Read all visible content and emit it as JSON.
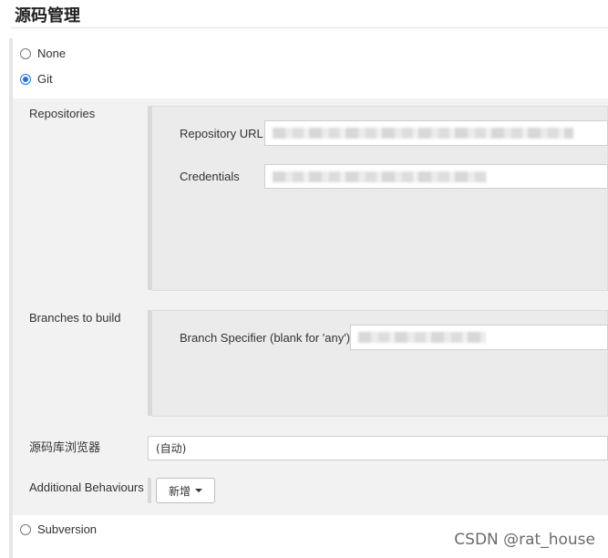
{
  "section": {
    "title": "源码管理"
  },
  "scm_options": {
    "none": {
      "label": "None",
      "selected": false
    },
    "git": {
      "label": "Git",
      "selected": true
    },
    "subversion": {
      "label": "Subversion",
      "selected": false
    }
  },
  "git": {
    "repositories": {
      "label": "Repositories",
      "repository_url": {
        "label": "Repository URL",
        "value": ""
      },
      "credentials": {
        "label": "Credentials",
        "value": ""
      }
    },
    "branches": {
      "label": "Branches to build",
      "branch_specifier": {
        "label": "Branch Specifier (blank for 'any')",
        "value": ""
      }
    },
    "browser": {
      "label": "源码库浏览器",
      "value": "(自动)"
    },
    "additional_behaviours": {
      "label": "Additional Behaviours",
      "add_button": "新增"
    }
  },
  "watermark": "CSDN @rat_house",
  "colors": {
    "radio_selected": "#1a73e8"
  }
}
